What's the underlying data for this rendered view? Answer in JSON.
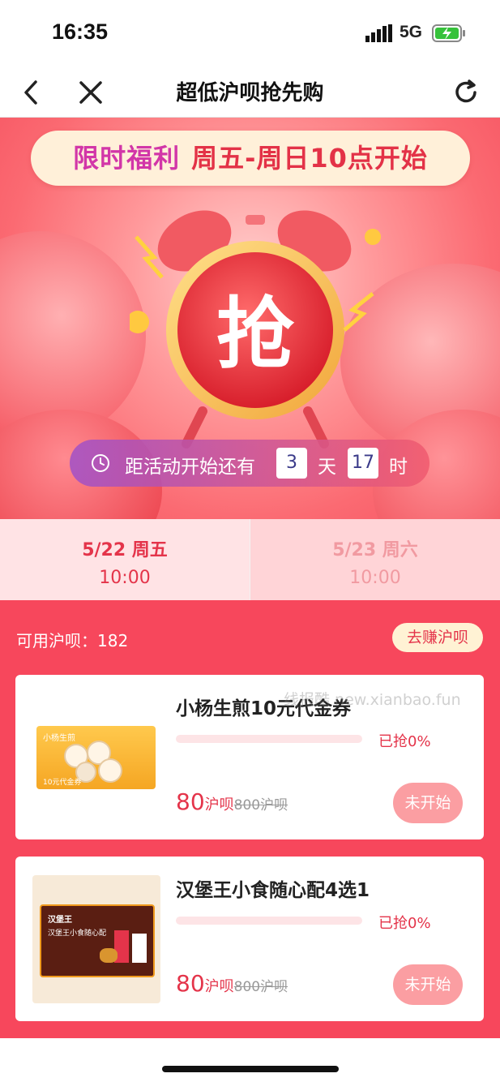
{
  "status": {
    "time": "16:35",
    "network": "5G"
  },
  "nav": {
    "title": "超低沪呗抢先购"
  },
  "hero": {
    "banner_left": "限时福利",
    "banner_right": "周五-周日10点开始",
    "clock_char": "抢",
    "countdown": {
      "prefix": "距活动开始还有",
      "days": "3",
      "day_unit": "天",
      "hours": "17",
      "hour_unit": "时"
    }
  },
  "date_tabs": [
    {
      "date": "5/22 周五",
      "time": "10:00"
    },
    {
      "date": "5/23 周六",
      "time": "10:00"
    }
  ],
  "points": {
    "label": "可用沪呗：182",
    "earn_label": "去赚沪呗"
  },
  "products": [
    {
      "title": "小杨生煎10元代金券",
      "progress": "已抢0%",
      "progress_value": 0,
      "price": "80",
      "price_unit": "沪呗",
      "original": "800沪呗",
      "button": "未开始",
      "img_brand": "小杨生煎",
      "img_caption": "10元代金券"
    },
    {
      "title": "汉堡王小食随心配4选1",
      "progress": "已抢0%",
      "progress_value": 0,
      "price": "80",
      "price_unit": "沪呗",
      "original": "800沪呗",
      "button": "未开始",
      "img_brand": "汉堡王",
      "img_caption": "汉堡王小食随心配"
    }
  ],
  "watermark": "线报酷 new.xianbao.fun",
  "colors": {
    "accent": "#e4344a",
    "main_bg": "#f7475c",
    "banner_bg": "#fff0d9"
  }
}
